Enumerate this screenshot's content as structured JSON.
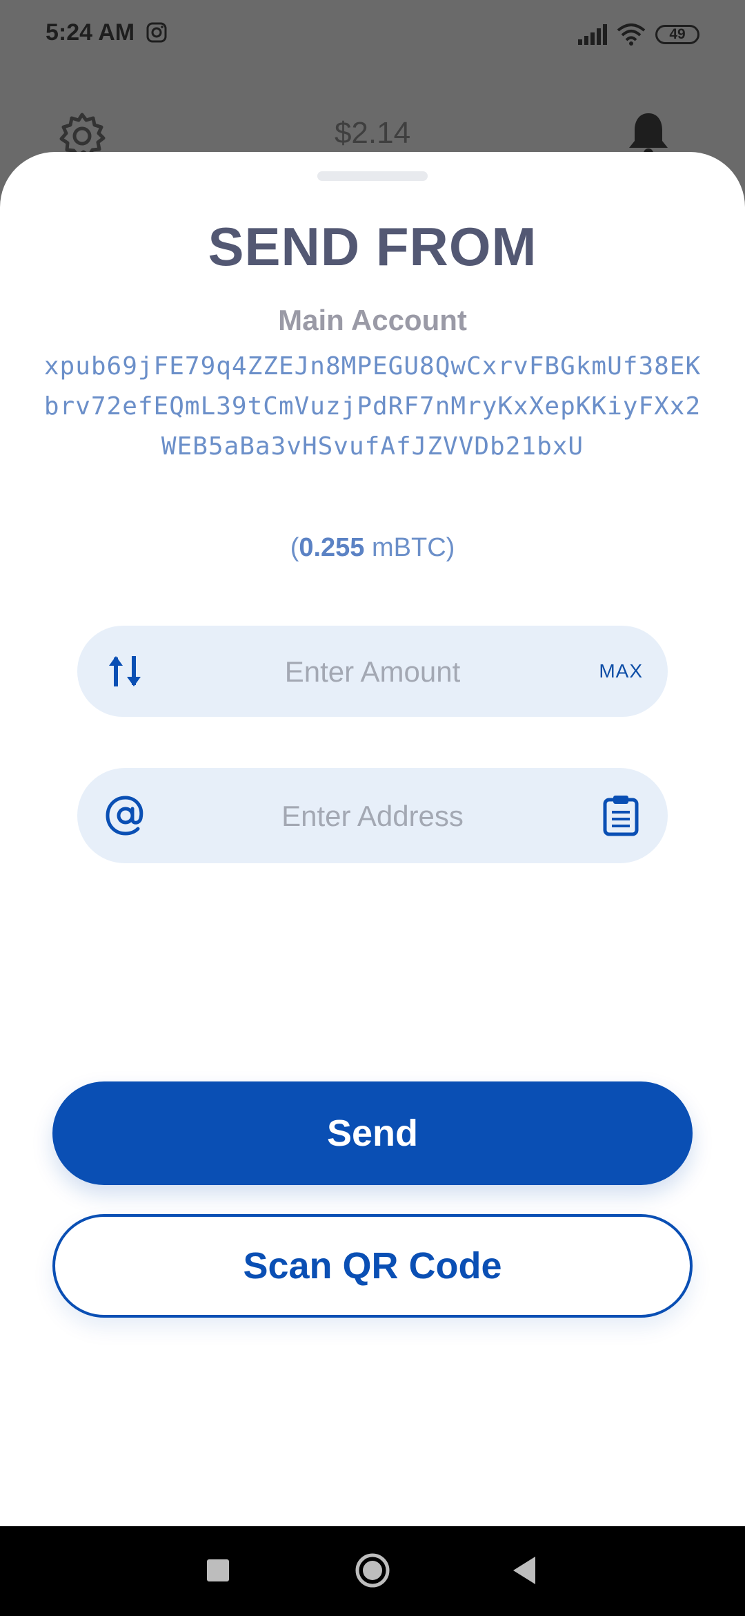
{
  "status_bar": {
    "time": "5:24 AM",
    "battery": "49",
    "icons": [
      "instagram-icon",
      "signal-icon",
      "wifi-icon",
      "battery-icon"
    ]
  },
  "background": {
    "balance": "$2.14",
    "icons": [
      "gear-icon",
      "bell-icon"
    ]
  },
  "sheet": {
    "title": "SEND FROM",
    "account_name": "Main Account",
    "xpub": "xpub69jFE79q4ZZEJn8MPEGU8QwCxrvFBGkmUf38EKbrv72efEQmL39tCmVuzjPdRF7nMryKxXepKKiyFXx2WEB5aBa3vHSvufAfJZVVDb21bxU",
    "balance_open": "(",
    "balance_value": "0.255",
    "balance_unit": "mBTC",
    "balance_close": ")",
    "amount_field": {
      "placeholder": "Enter Amount",
      "max_label": "MAX",
      "icon": "swap-arrows-icon"
    },
    "address_field": {
      "placeholder": "Enter Address",
      "icon": "at-sign-icon",
      "paste_icon": "clipboard-icon"
    },
    "send_label": "Send",
    "scan_label": "Scan QR Code"
  },
  "colors": {
    "accent": "#0a4fb4",
    "field_bg": "#e7eff9",
    "title": "#535873",
    "xpub": "#6b8fc9"
  }
}
